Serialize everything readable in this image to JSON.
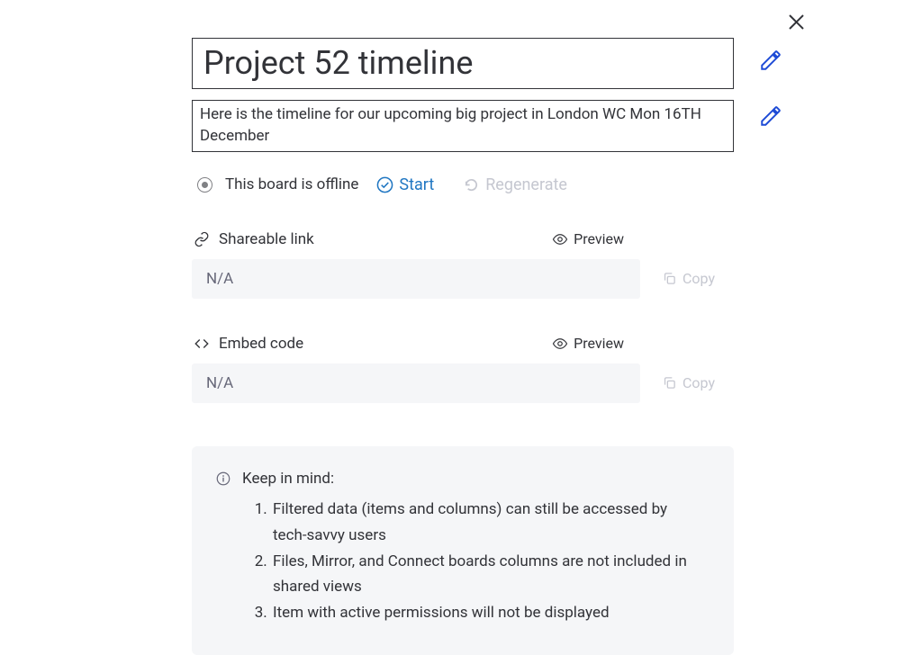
{
  "title": "Project 52 timeline",
  "description": "Here is the timeline for our upcoming big project in London WC Mon 16TH December",
  "status": {
    "offline_text": "This board is offline",
    "start_label": "Start",
    "regenerate_label": "Regenerate"
  },
  "share": {
    "title": "Shareable link",
    "preview_label": "Preview",
    "value": "N/A",
    "copy_label": "Copy"
  },
  "embed": {
    "title": "Embed code",
    "preview_label": "Preview",
    "value": "N/A",
    "copy_label": "Copy"
  },
  "keep": {
    "heading": "Keep in mind:",
    "items": [
      "Filtered data (items and columns) can still be accessed by tech-savvy users",
      "Files, Mirror, and Connect boards columns are not included in shared views",
      "Item with active permissions will not be displayed"
    ]
  }
}
